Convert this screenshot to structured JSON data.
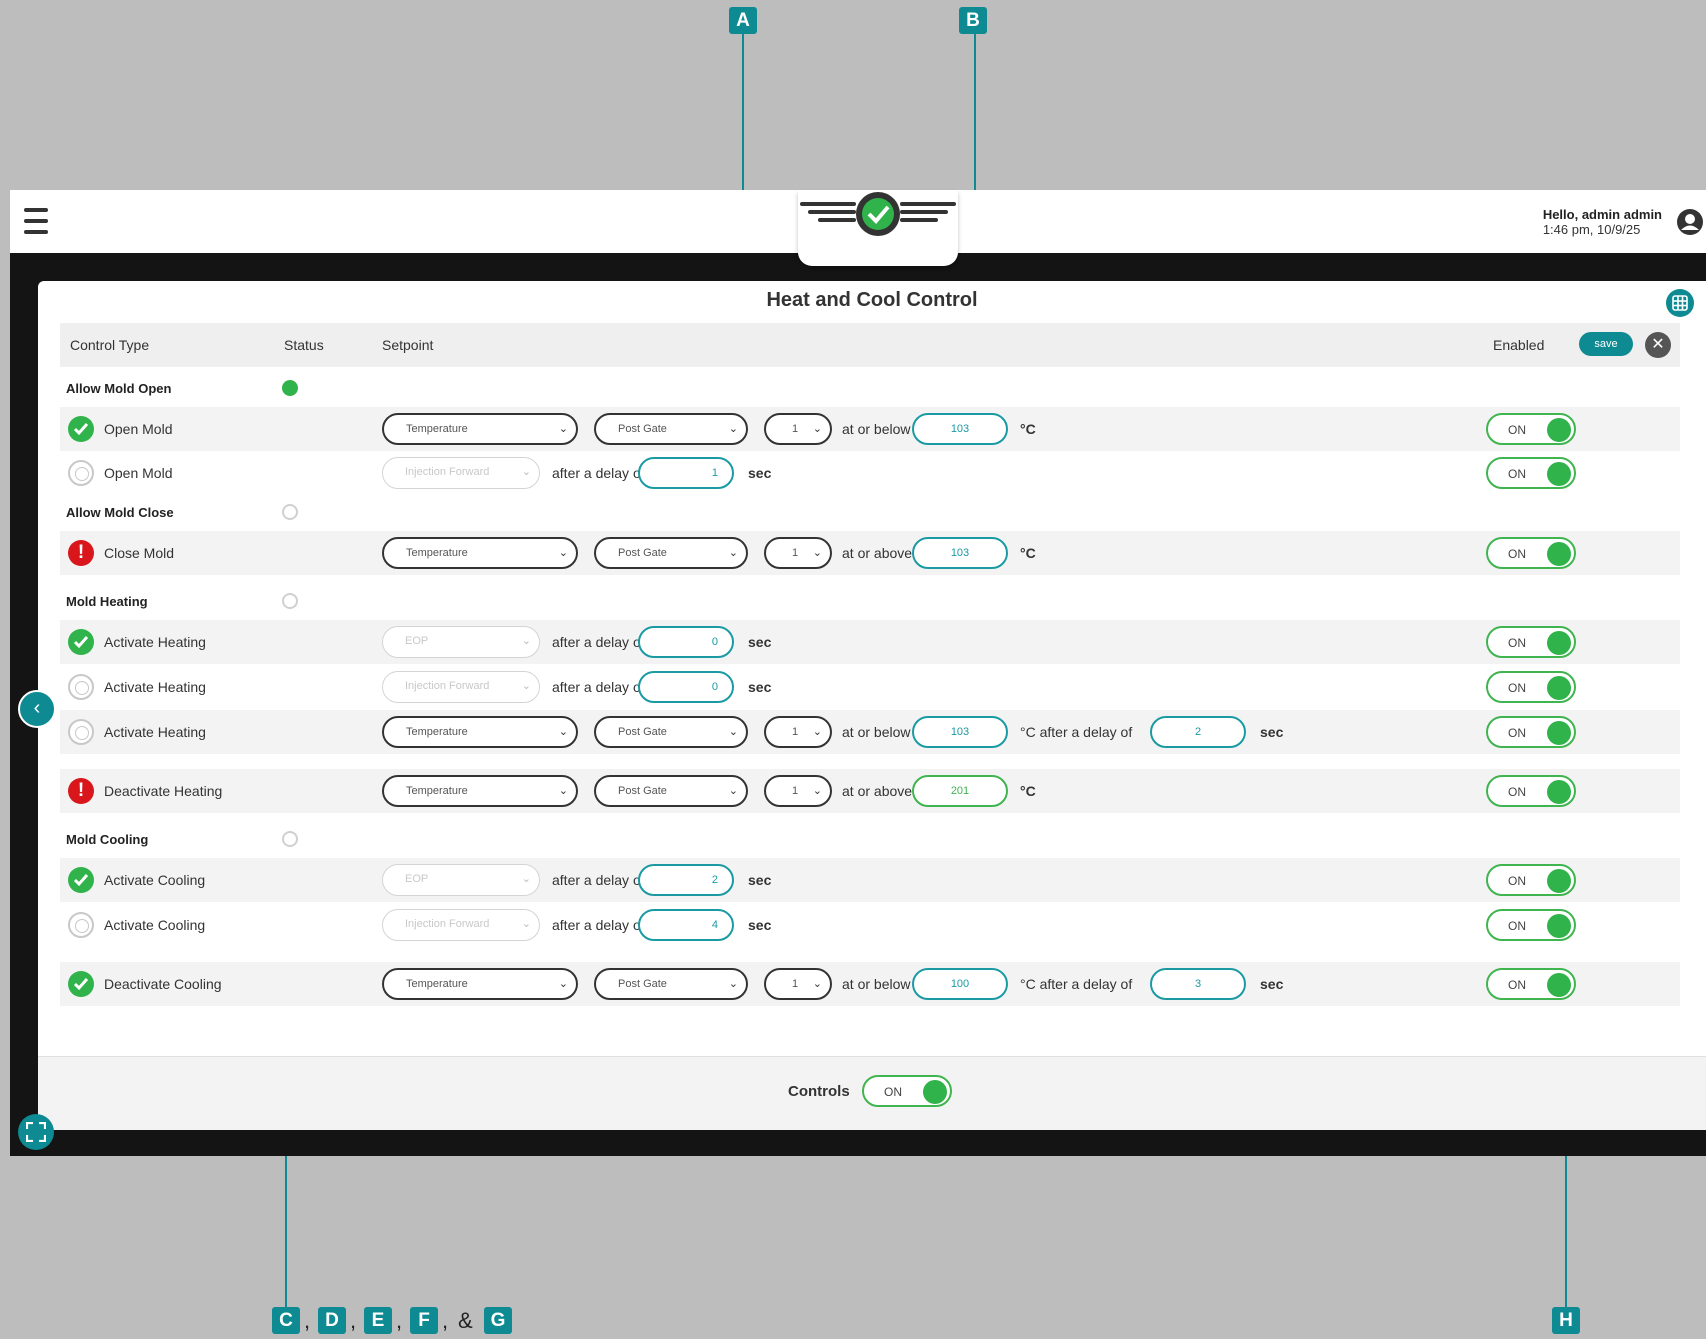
{
  "header": {
    "greeting": "Hello, admin admin",
    "datetime": "1:46 pm, 10/9/25"
  },
  "panel": {
    "title": "Heat and Cool Control"
  },
  "columns": {
    "control_type": "Control Type",
    "status": "Status",
    "setpoint": "Setpoint",
    "enabled": "Enabled"
  },
  "actions": {
    "save_label": "save"
  },
  "sections": {
    "allow_open": "Allow Mold Open",
    "allow_close": "Allow Mold Close",
    "heating": "Mold Heating",
    "cooling": "Mold Cooling"
  },
  "rows": [
    {
      "name": "Open Mold",
      "status": "ok",
      "type": "Temperature",
      "gate": "Post Gate",
      "num": "1",
      "cond": "at or below",
      "temp": "103",
      "unit": "°C",
      "enabled": "ON"
    },
    {
      "name": "Open Mold",
      "status": "pending",
      "type": "Injection Forward",
      "delay_label": "after a delay of",
      "delay": "1",
      "sec": "sec",
      "enabled": "ON"
    },
    {
      "name": "Close Mold",
      "status": "alert",
      "type": "Temperature",
      "gate": "Post Gate",
      "num": "1",
      "cond": "at or above",
      "temp": "103",
      "unit": "°C",
      "enabled": "ON"
    },
    {
      "name": "Activate Heating",
      "status": "ok",
      "type": "EOP",
      "delay_label": "after a delay of",
      "delay": "0",
      "sec": "sec",
      "enabled": "ON"
    },
    {
      "name": "Activate Heating",
      "status": "pending",
      "type": "Injection Forward",
      "delay_label": "after a delay of",
      "delay": "0",
      "sec": "sec",
      "enabled": "ON"
    },
    {
      "name": "Activate Heating",
      "status": "pending",
      "type": "Temperature",
      "gate": "Post Gate",
      "num": "1",
      "cond": "at or below",
      "temp": "103",
      "unit": "°C after a delay of",
      "delay2": "2",
      "sec": "sec",
      "enabled": "ON"
    },
    {
      "name": "Deactivate Heating",
      "status": "alert",
      "type": "Temperature",
      "gate": "Post Gate",
      "num": "1",
      "cond": "at or above",
      "temp": "201",
      "unit": "°C",
      "enabled": "ON"
    },
    {
      "name": "Activate Cooling",
      "status": "ok",
      "type": "EOP",
      "delay_label": "after a delay of",
      "delay": "2",
      "sec": "sec",
      "enabled": "ON"
    },
    {
      "name": "Activate Cooling",
      "status": "pending",
      "type": "Injection Forward",
      "delay_label": "after a delay of",
      "delay": "4",
      "sec": "sec",
      "enabled": "ON"
    },
    {
      "name": "Deactivate Cooling",
      "status": "ok",
      "type": "Temperature",
      "gate": "Post Gate",
      "num": "1",
      "cond": "at or below",
      "temp": "100",
      "unit": "°C after a delay of",
      "delay2": "3",
      "sec": "sec",
      "enabled": "ON"
    }
  ],
  "footer": {
    "controls_label": "Controls",
    "controls_toggle": "ON"
  },
  "callouts": {
    "a": "A",
    "b": "B",
    "c": "C",
    "d": "D",
    "e": "E",
    "f": "F",
    "g": "G",
    "h": "H",
    "comma": ",",
    "amp": "&"
  },
  "colors": {
    "accent": "#0e8a93",
    "ok": "#2fb34a",
    "alert": "#d9161b"
  }
}
